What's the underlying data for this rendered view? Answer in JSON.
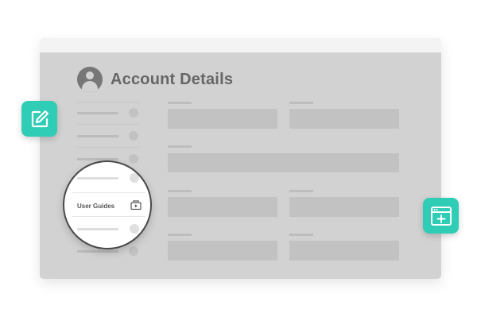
{
  "page": {
    "title": "Account Details"
  },
  "sidebar": {
    "highlighted_item": "User Guides"
  },
  "icons": {
    "left_badge": "edit-icon",
    "right_badge": "new-window-icon",
    "guide_icon": "video-icon",
    "avatar": "user-avatar-icon"
  },
  "colors": {
    "accent": "#2fcdb6",
    "window_bg": "#d2d2d2",
    "title_text": "#666666"
  }
}
